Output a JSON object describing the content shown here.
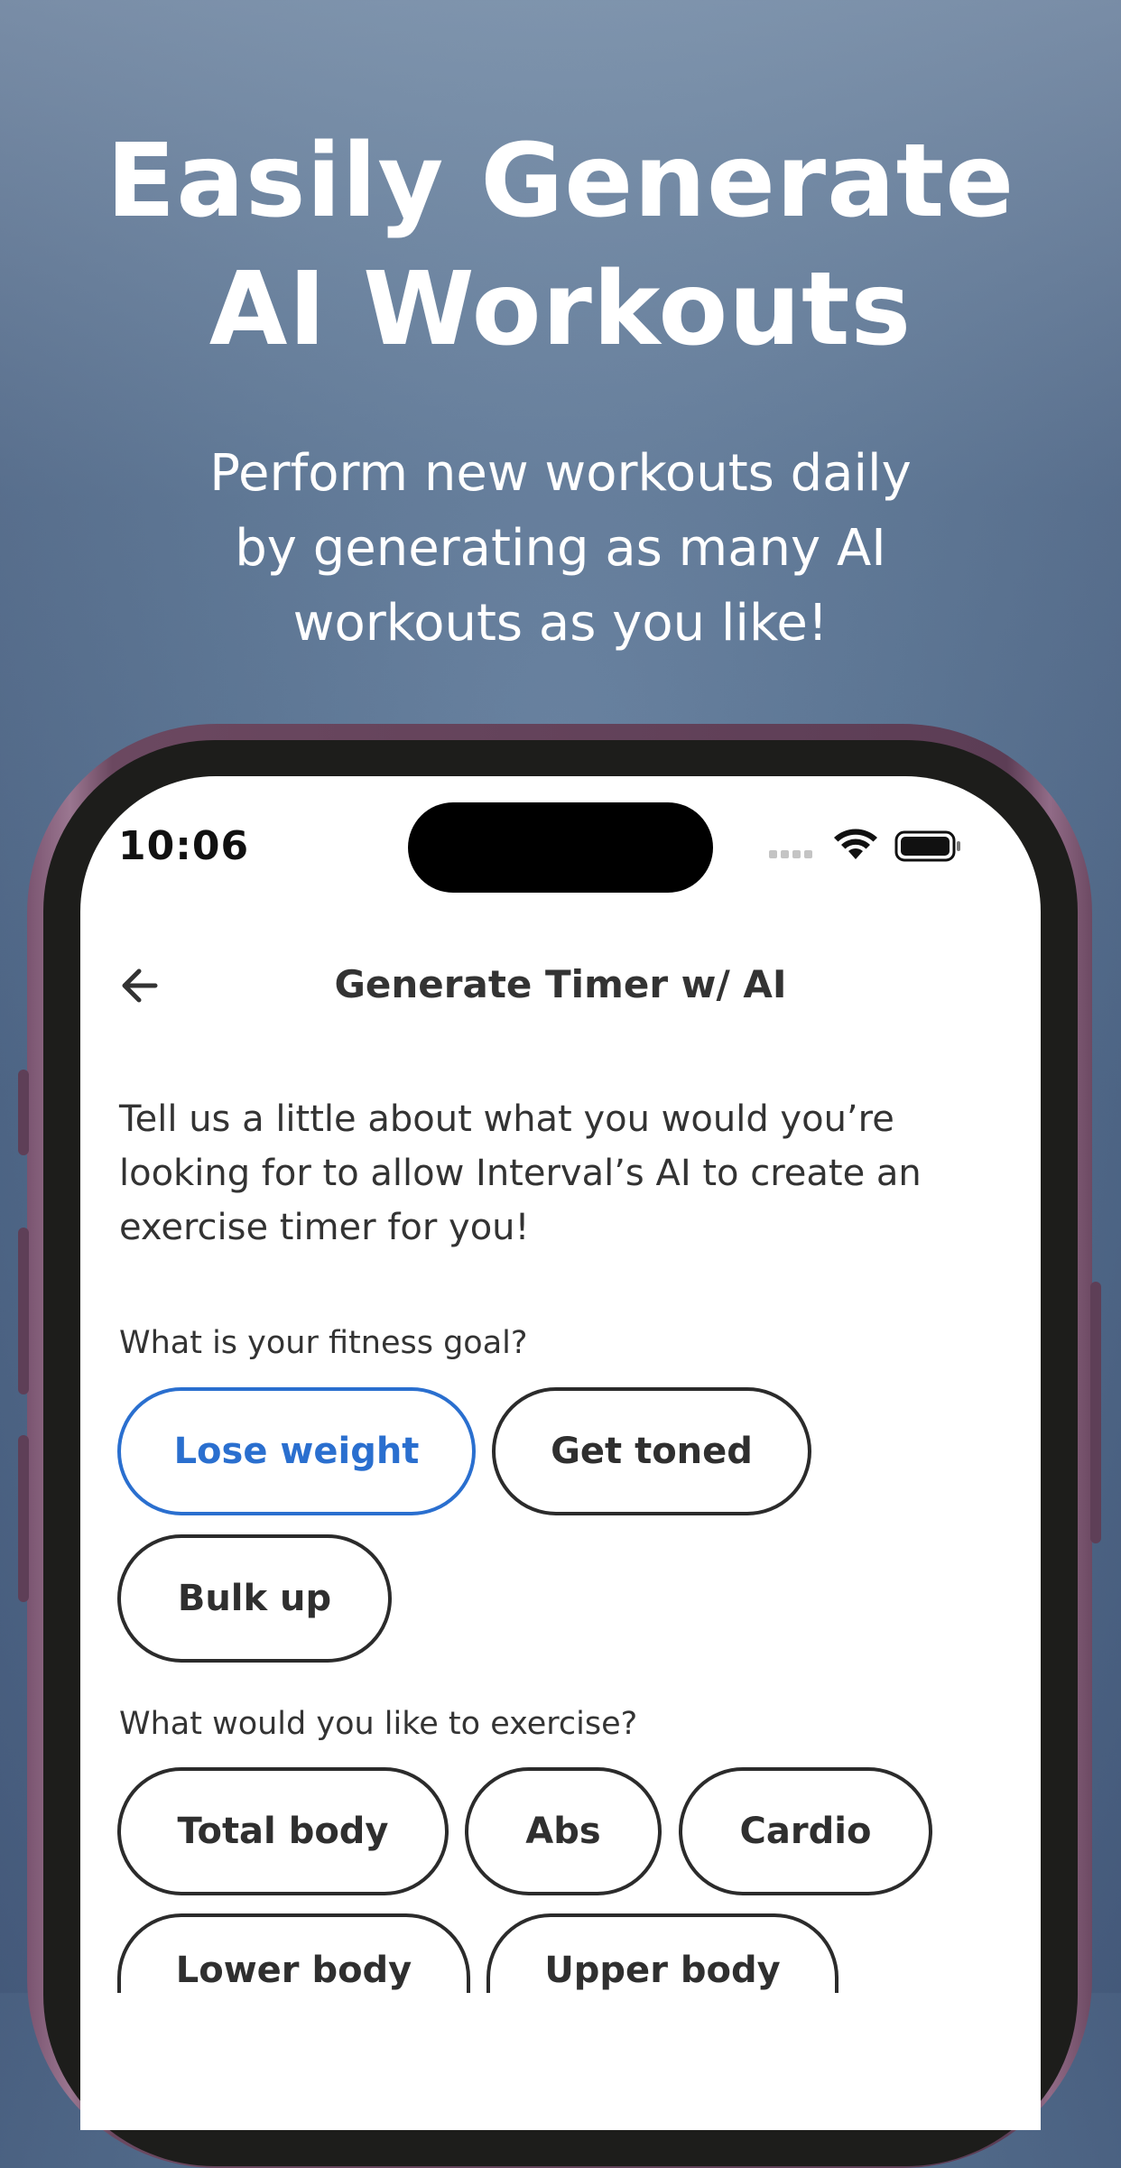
{
  "marketing": {
    "headline_line1": "Easily Generate",
    "headline_line2": "AI Workouts",
    "subhead_line1": "Perform new workouts daily",
    "subhead_line2": "by generating as many AI",
    "subhead_line3": "workouts as you like!"
  },
  "status_bar": {
    "time": "10:06"
  },
  "nav": {
    "back_icon": "arrow-left-icon",
    "title": "Generate Timer w/ AI"
  },
  "intro": {
    "line1": "Tell us a little about what you would you’re",
    "line2": "looking for to allow Interval’s AI to create an",
    "line3": "exercise timer for you!"
  },
  "fitness_goal": {
    "question": "What is your fitness goal?",
    "options": [
      {
        "label": "Lose weight",
        "selected": true
      },
      {
        "label": "Get toned",
        "selected": false
      },
      {
        "label": "Bulk up",
        "selected": false
      }
    ]
  },
  "exercise_area": {
    "question": "What would you like to exercise?",
    "options": [
      {
        "label": "Total body",
        "selected": false
      },
      {
        "label": "Abs",
        "selected": false
      },
      {
        "label": "Cardio",
        "selected": false
      },
      {
        "label": "Lower body",
        "selected": false
      },
      {
        "label": "Upper body",
        "selected": false
      }
    ]
  },
  "colors": {
    "selected_accent": "#2a6fcf",
    "chip_border": "#2b2b2b",
    "phone_frame": "#7a5470"
  }
}
